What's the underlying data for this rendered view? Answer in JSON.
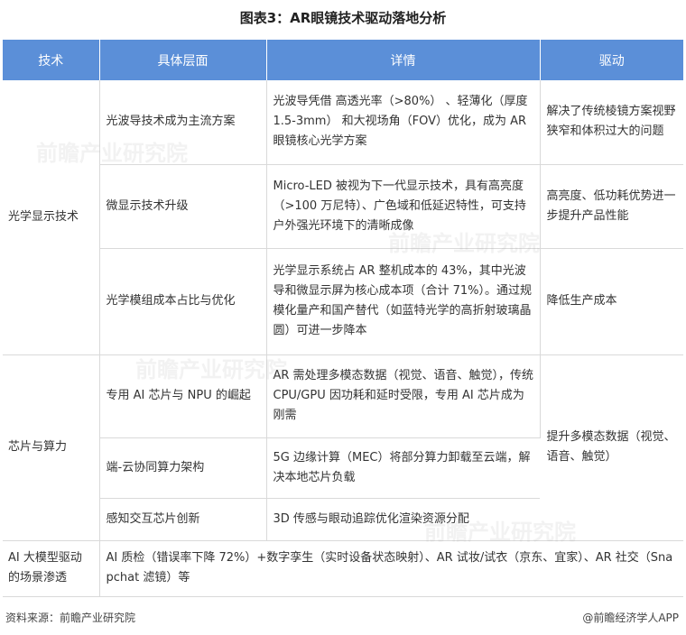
{
  "title": "图表3：AR眼镜技术驱动落地分析",
  "headers": [
    "技术",
    "具体层面",
    "详情",
    "驱动"
  ],
  "groups": {
    "optical": {
      "tech": "光学显示技术",
      "rows": [
        {
          "aspect": "光波导技术成为主流方案",
          "detail": "光波导凭借 高透光率（>80%） 、轻薄化（厚度 1.5-3mm） 和大视场角（FOV）优化，成为 AR 眼镜核心光学方案",
          "driver": "解决了传统棱镜方案视野狭窄和体积过大的问题"
        },
        {
          "aspect": "微显示技术升级",
          "detail": "Micro-LED 被视为下一代显示技术，具有高亮度（>100 万尼特）、广色域和低延迟特性，可支持户外强光环境下的清晰成像",
          "driver": "高亮度、低功耗优势进一步提升产品性能"
        },
        {
          "aspect": "光学模组成本占比与优化",
          "detail": "光学显示系统占 AR 整机成本的 43%，其中光波导和微显示屏为核心成本项（合计 71%）。通过规模化量产和国产替代（如蓝特光学的高折射玻璃晶圆）可进一步降本",
          "driver": "降低生产成本"
        }
      ]
    },
    "chips": {
      "tech": "芯片与算力",
      "driver": "提升多模态数据（视觉、语音、触觉）",
      "rows": [
        {
          "aspect": "专用 AI 芯片与 NPU 的崛起",
          "detail": "AR 需处理多模态数据（视觉、语音、触觉），传统 CPU/GPU 因功耗和延时受限，专用 AI 芯片成为刚需"
        },
        {
          "aspect": "端-云协同算力架构",
          "detail": "5G 边缘计算（MEC）将部分算力卸载至云端，解决本地芯片负载"
        },
        {
          "aspect": "感知交互芯片创新",
          "detail": "3D 传感与眼动追踪优化渲染资源分配"
        }
      ]
    },
    "ai": {
      "tech": "AI 大模型驱动的场景渗透",
      "detail": "AI 质检（错误率下降 72%）+数字孪生（实时设备状态映射）、AR 试妆/试衣（京东、宜家）、AR 社交（Snapchat 滤镜）等"
    }
  },
  "footer": {
    "source": "资料来源：前瞻产业研究院",
    "brand": "@前瞻经济学人APP"
  },
  "watermark": "前瞻产业研究院"
}
